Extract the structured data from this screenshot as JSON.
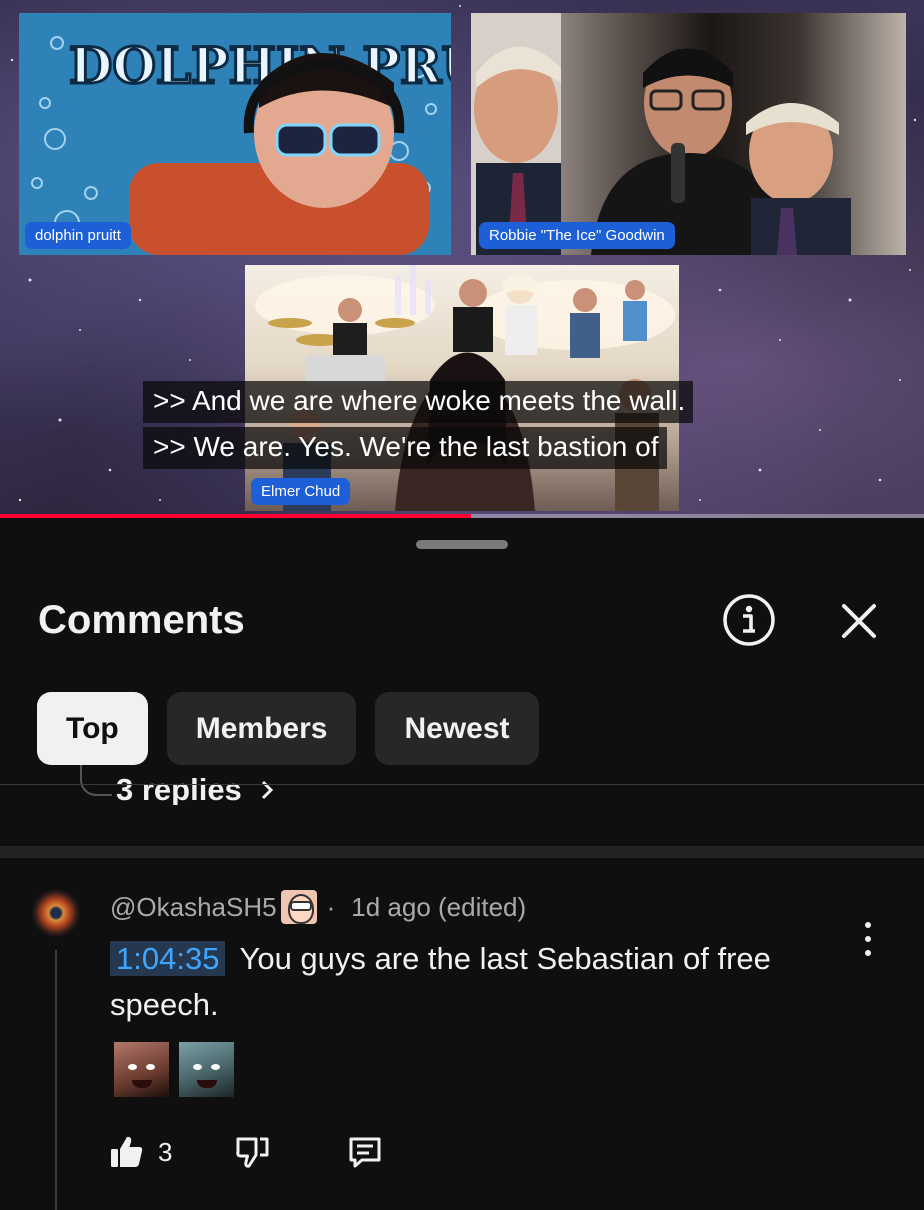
{
  "video": {
    "participants": [
      {
        "name": "dolphin pruitt"
      },
      {
        "name": "Robbie \"The Ice\" Goodwin"
      },
      {
        "name": "Elmer Chud"
      }
    ],
    "tile_1_logo_text": "DOLPHIN PRUITT",
    "captions": [
      ">> And we are where woke meets the wall.",
      ">> We are. Yes. We're the last bastion of"
    ],
    "progress": 0.51,
    "progress_color": "#ff0033"
  },
  "comments_panel": {
    "title": "Comments",
    "info_icon": "info-icon",
    "close_icon": "close-icon",
    "tabs": [
      {
        "label": "Top",
        "active": true
      },
      {
        "label": "Members",
        "active": false
      },
      {
        "label": "Newest",
        "active": false
      }
    ],
    "previous_thread": {
      "replies_label": "3 replies"
    },
    "comment": {
      "author": "@OkashaSH5",
      "separator": "·",
      "time": "1d ago (edited)",
      "timestamp_link": "1:04:35",
      "text": "You guys are the last Sebastian of free speech.",
      "likes": "3",
      "icons": [
        "like-icon",
        "dislike-icon",
        "reply-icon",
        "more-vert-icon"
      ]
    }
  },
  "colors": {
    "background": "#0f0f0f",
    "chip_bg": "#272727",
    "chip_active_bg": "#f1f1f1",
    "link_blue": "#3ea6ff",
    "name_tag_blue": "#1d5fd6"
  }
}
